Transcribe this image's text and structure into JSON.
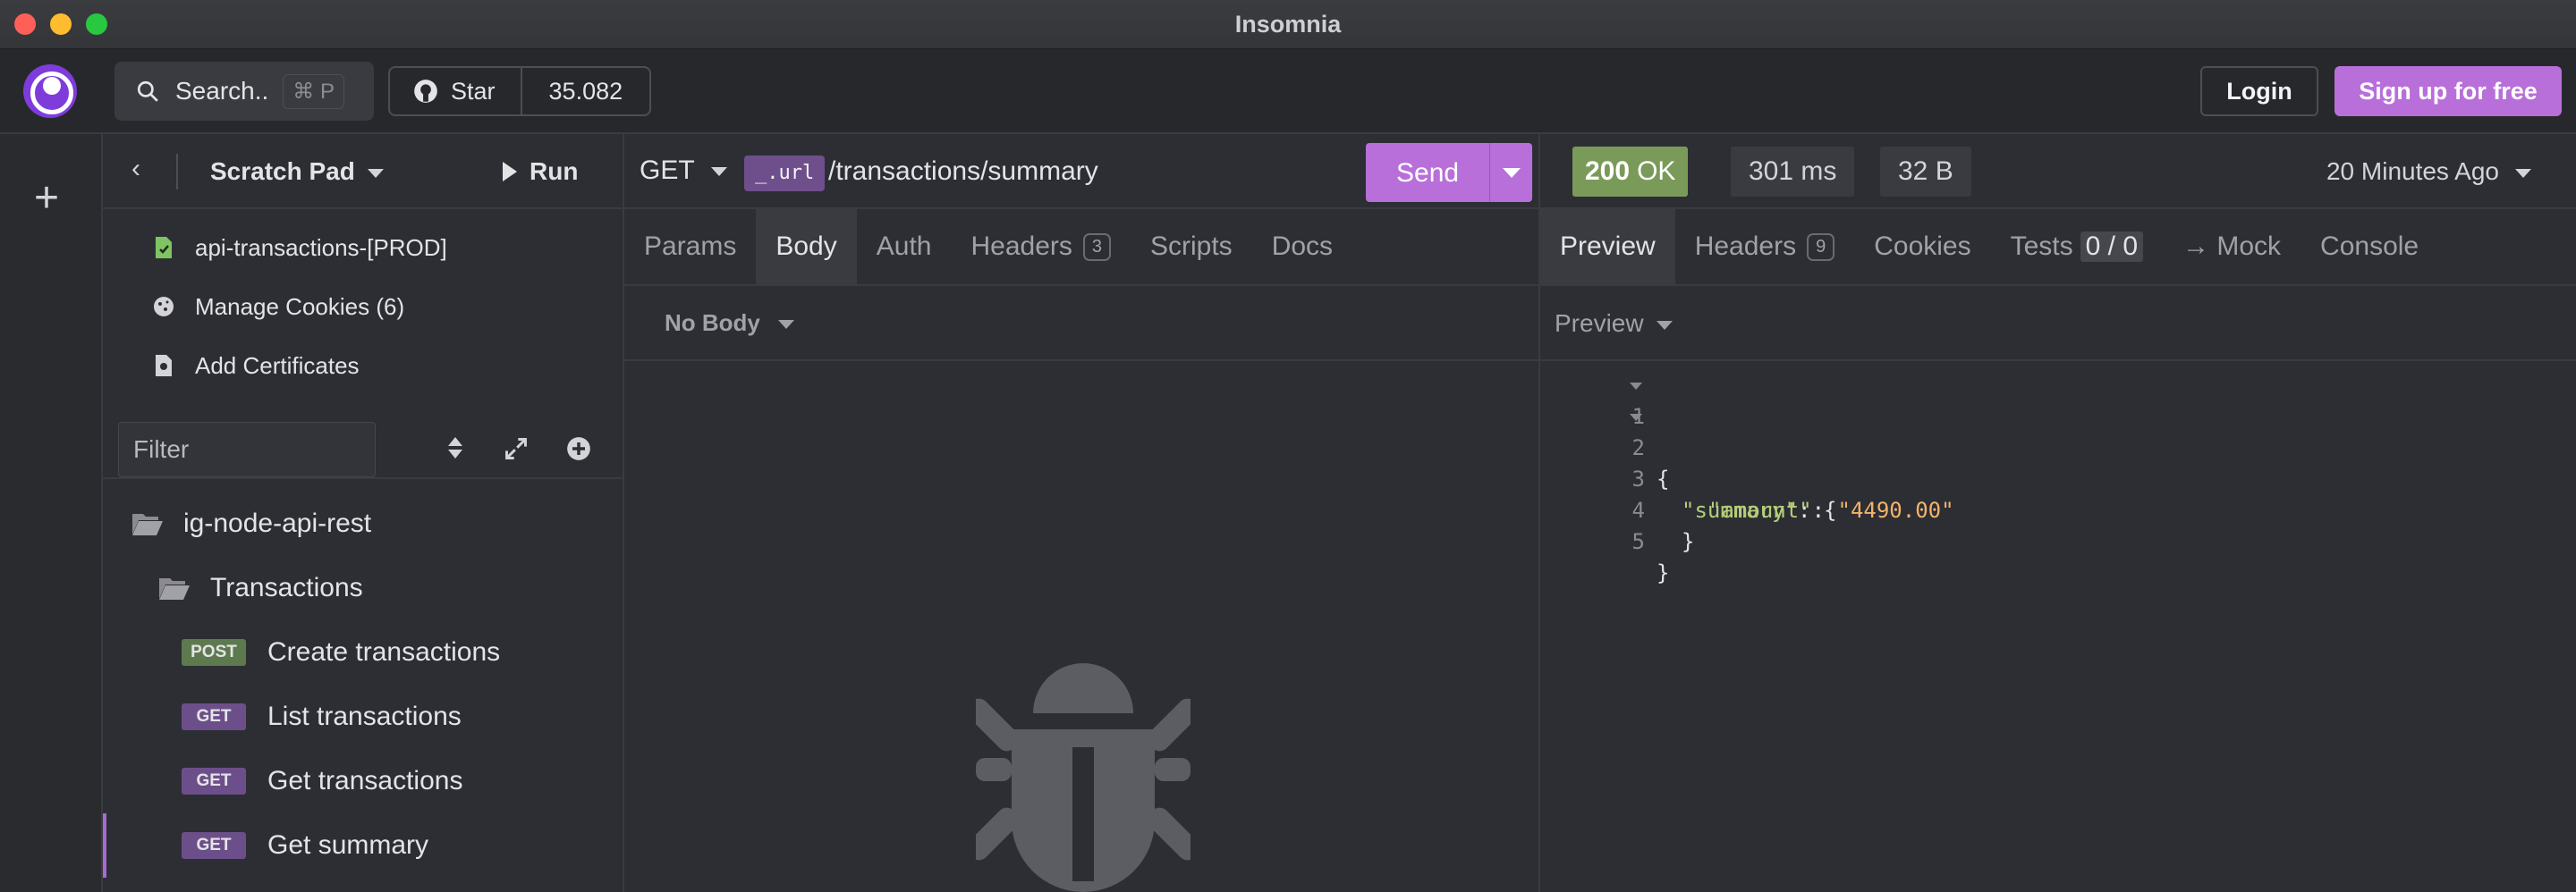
{
  "window": {
    "title": "Insomnia"
  },
  "header": {
    "search_label": "Search..",
    "search_shortcut": "⌘ P",
    "star_label": "Star",
    "star_count": "35.082",
    "login_label": "Login",
    "signup_label": "Sign up for free"
  },
  "sidebar": {
    "collection_label": "Scratch Pad",
    "run_label": "Run",
    "links": [
      {
        "label": "api-transactions-[PROD]",
        "icon": "env-file-icon"
      },
      {
        "label": "Manage Cookies (6)",
        "icon": "cookie-icon"
      },
      {
        "label": "Add Certificates",
        "icon": "certificate-icon"
      }
    ],
    "filter_placeholder": "Filter",
    "project": "ig-node-api-rest",
    "folder": "Transactions",
    "requests": [
      {
        "method": "POST",
        "name": "Create transactions"
      },
      {
        "method": "GET",
        "name": "List transactions"
      },
      {
        "method": "GET",
        "name": "Get transactions"
      },
      {
        "method": "GET",
        "name": "Get summary",
        "active": true
      }
    ]
  },
  "request": {
    "method": "GET",
    "url_var": "_.url",
    "url_path": "/transactions/summary",
    "send_label": "Send",
    "tabs": [
      {
        "label": "Params"
      },
      {
        "label": "Body",
        "active": true
      },
      {
        "label": "Auth"
      },
      {
        "label": "Headers",
        "badge": "3"
      },
      {
        "label": "Scripts"
      },
      {
        "label": "Docs"
      }
    ],
    "body_type": "No Body"
  },
  "response": {
    "status_code": "200",
    "status_text": "OK",
    "time": "301 ms",
    "size": "32 B",
    "time_ago": "20 Minutes Ago",
    "tabs": [
      {
        "label": "Preview",
        "active": true
      },
      {
        "label": "Headers",
        "badge": "9"
      },
      {
        "label": "Cookies"
      },
      {
        "label": "Tests",
        "count": "0 / 0"
      },
      {
        "label": "→ Mock"
      },
      {
        "label": "Console"
      }
    ],
    "preview_mode": "Preview",
    "lines": [
      {
        "n": "1",
        "fold": true
      },
      {
        "n": "2",
        "fold": true
      },
      {
        "n": "3",
        "fold": false
      },
      {
        "n": "4",
        "fold": false
      },
      {
        "n": "5",
        "fold": false
      }
    ],
    "json": {
      "open_brace": "{",
      "summary_key": "\"summary\"",
      "summary_colon": ": {",
      "amount_key": "\"amount\"",
      "amount_colon": ": ",
      "amount_value": "\"4490.00\"",
      "inner_close": "}",
      "outer_close": "}"
    }
  }
}
